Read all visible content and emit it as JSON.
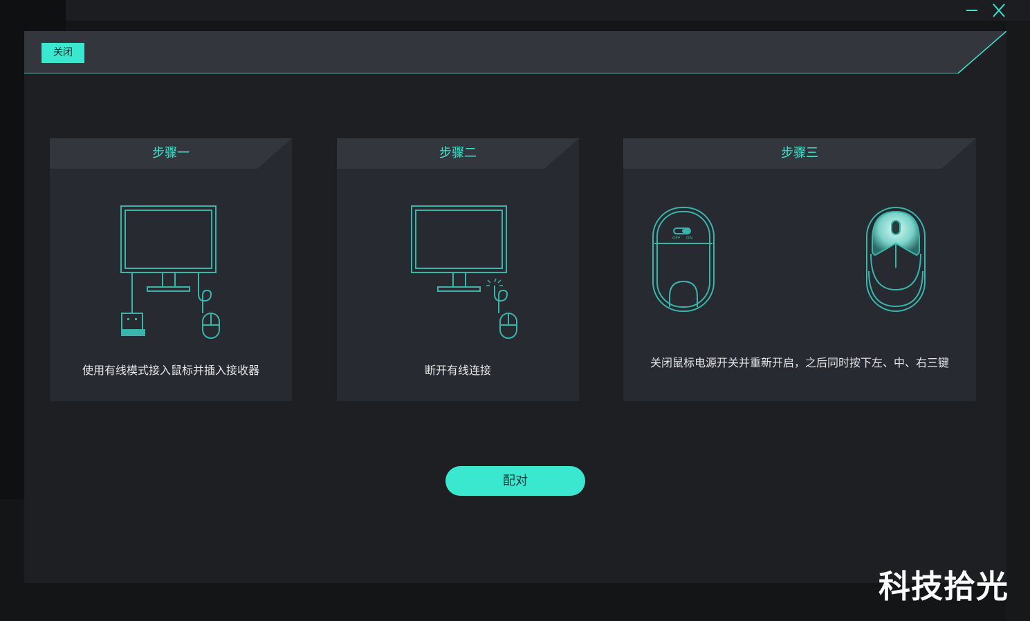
{
  "window": {
    "minimize_icon": "minimize-icon",
    "close_icon": "close-x-icon"
  },
  "dialog": {
    "close_label": "关闭",
    "accent_color": "#3ae8d0"
  },
  "steps": [
    {
      "title": "步骤一",
      "description": "使用有线模式接入鼠标并插入接收器",
      "icons": [
        "monitor-icon",
        "usb-receiver-icon",
        "wired-mouse-icon"
      ]
    },
    {
      "title": "步骤二",
      "description": "断开有线连接",
      "icons": [
        "monitor-icon",
        "disconnected-mouse-icon"
      ]
    },
    {
      "title": "步骤三",
      "description": "关闭鼠标电源开关并重新开启，之后同时按下左、中、右三键",
      "icons": [
        "mouse-bottom-power-switch-icon",
        "mouse-top-three-buttons-icon"
      ],
      "switch_labels": [
        "OFF",
        "ON"
      ]
    }
  ],
  "pair_label": "配对",
  "watermark": "科技拾光"
}
